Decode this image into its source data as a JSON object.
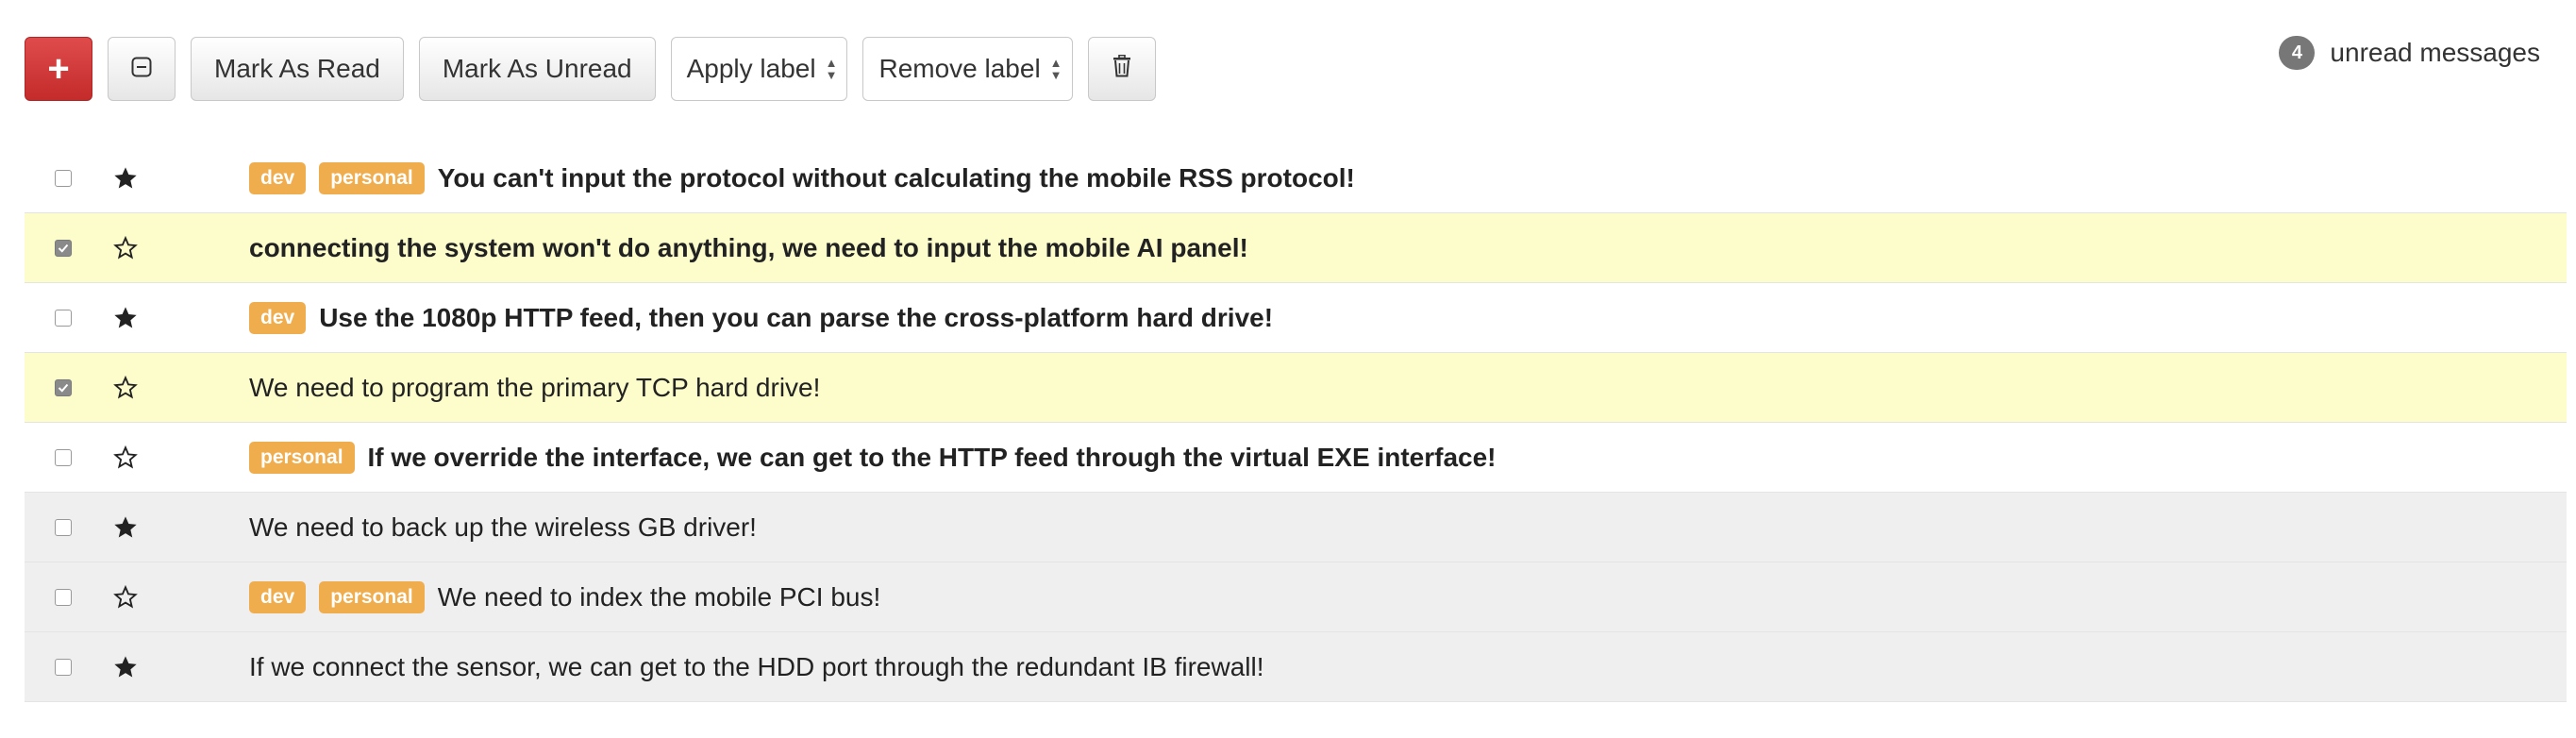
{
  "toolbar": {
    "compose_label": "+",
    "mark_read_label": "Mark As Read",
    "mark_unread_label": "Mark As Unread",
    "apply_label": "Apply label",
    "remove_label": "Remove label"
  },
  "unread": {
    "count": "4",
    "text": "unread messages"
  },
  "colors": {
    "compose": "#d9534f",
    "label": "#f0ad4e",
    "selected": "#fdfdcc",
    "read_row": "#efefef"
  },
  "messages": [
    {
      "subject": "You can't input the protocol without calculating the mobile RSS protocol!",
      "labels": [
        "dev",
        "personal"
      ],
      "starred": true,
      "selected": false,
      "read": false
    },
    {
      "subject": "connecting the system won't do anything, we need to input the mobile AI panel!",
      "labels": [],
      "starred": false,
      "selected": true,
      "read": false
    },
    {
      "subject": "Use the 1080p HTTP feed, then you can parse the cross-platform hard drive!",
      "labels": [
        "dev"
      ],
      "starred": true,
      "selected": false,
      "read": false
    },
    {
      "subject": "We need to program the primary TCP hard drive!",
      "labels": [],
      "starred": false,
      "selected": true,
      "read": true
    },
    {
      "subject": "If we override the interface, we can get to the HTTP feed through the virtual EXE interface!",
      "labels": [
        "personal"
      ],
      "starred": false,
      "selected": false,
      "read": false
    },
    {
      "subject": "We need to back up the wireless GB driver!",
      "labels": [],
      "starred": true,
      "selected": false,
      "read": true
    },
    {
      "subject": "We need to index the mobile PCI bus!",
      "labels": [
        "dev",
        "personal"
      ],
      "starred": false,
      "selected": false,
      "read": true
    },
    {
      "subject": "If we connect the sensor, we can get to the HDD port through the redundant IB firewall!",
      "labels": [],
      "starred": true,
      "selected": false,
      "read": true
    }
  ]
}
